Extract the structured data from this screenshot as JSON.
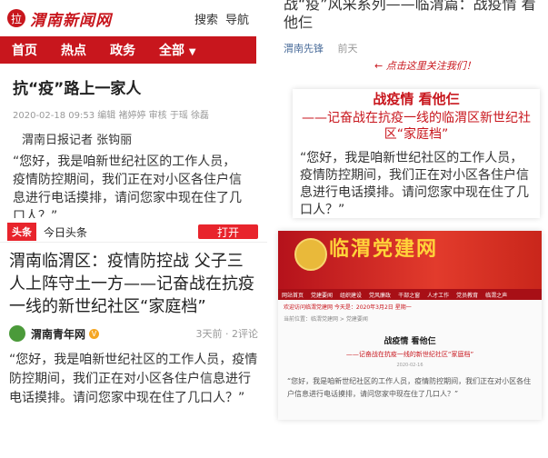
{
  "p1": {
    "logo_icon": "拉",
    "logo_text": "渭南新闻网",
    "search": "搜索",
    "nav_link": "导航",
    "tabs": [
      "首页",
      "热点",
      "政务",
      "全部"
    ],
    "title": "抗“疫”路上一家人",
    "meta": "2020-02-18 09:53  编辑 褚婷婷  审核 于瑶  徐磊",
    "byline": "渭南日报记者 张钩丽",
    "body": "“您好，我是咱新世纪社区的工作人员，疫情防控期间，我们正在对小区各住户信息进行电话摸排，请问您家中现在住了几口人？”"
  },
  "p2": {
    "title": "战“疫”风采系列——临渭篇：战疫情 看他仨",
    "source": "渭南先锋",
    "time": "前天",
    "handwritten": "← 点击这里关注我们！"
  },
  "p3": {
    "title": "战疫情  看他仨",
    "subtitle": "——记奋战在抗疫一线的临渭区新世纪社区“家庭档”",
    "body": "“您好，我是咱新世纪社区的工作人员，疫情防控期间，我们正在对小区各住户信息进行电话摸排。请问您家中现在住了几口人？”"
  },
  "p4": {
    "app_logo": "头条",
    "app_name": "今日头条",
    "open_button": "打开",
    "title": "渭南临渭区：疫情防控战 父子三人上阵守土一方——记奋战在抗疫一线的新世纪社区“家庭档”",
    "source": "渭南青年网",
    "verified": "V",
    "time": "3天前 · 2评论",
    "body": "“您好，我是咱新世纪社区的工作人员，疫情防控期间，我们正在对小区各住户信息进行电话摸排。请问您家中现在住了几口人？”"
  },
  "p5": {
    "logo": "临渭党建网",
    "nav": [
      "网站首页",
      "党建要闻",
      "组织建设",
      "党风廉政",
      "干部之窗",
      "人才工作",
      "党员教育",
      "临渭之声"
    ],
    "notice": "欢迎访问临渭党建网  今天是：2020年3月2日 星期一",
    "location": "当前位置：临渭党建网 > 党建要闻",
    "title": "战疫情  看他仨",
    "subtitle": "——记奋战在抗疫一线的新世纪社区“家庭档”",
    "date": "2020-02-16",
    "body": "“您好，我是咱新世纪社区的工作人员，疫情防控期间，我们正在对小区各住户信息进行电话摸排，请问您家中现在住了几口人？”"
  },
  "colors": {
    "brand_red": "#c8161d",
    "toutiao_red": "#e8242c"
  }
}
